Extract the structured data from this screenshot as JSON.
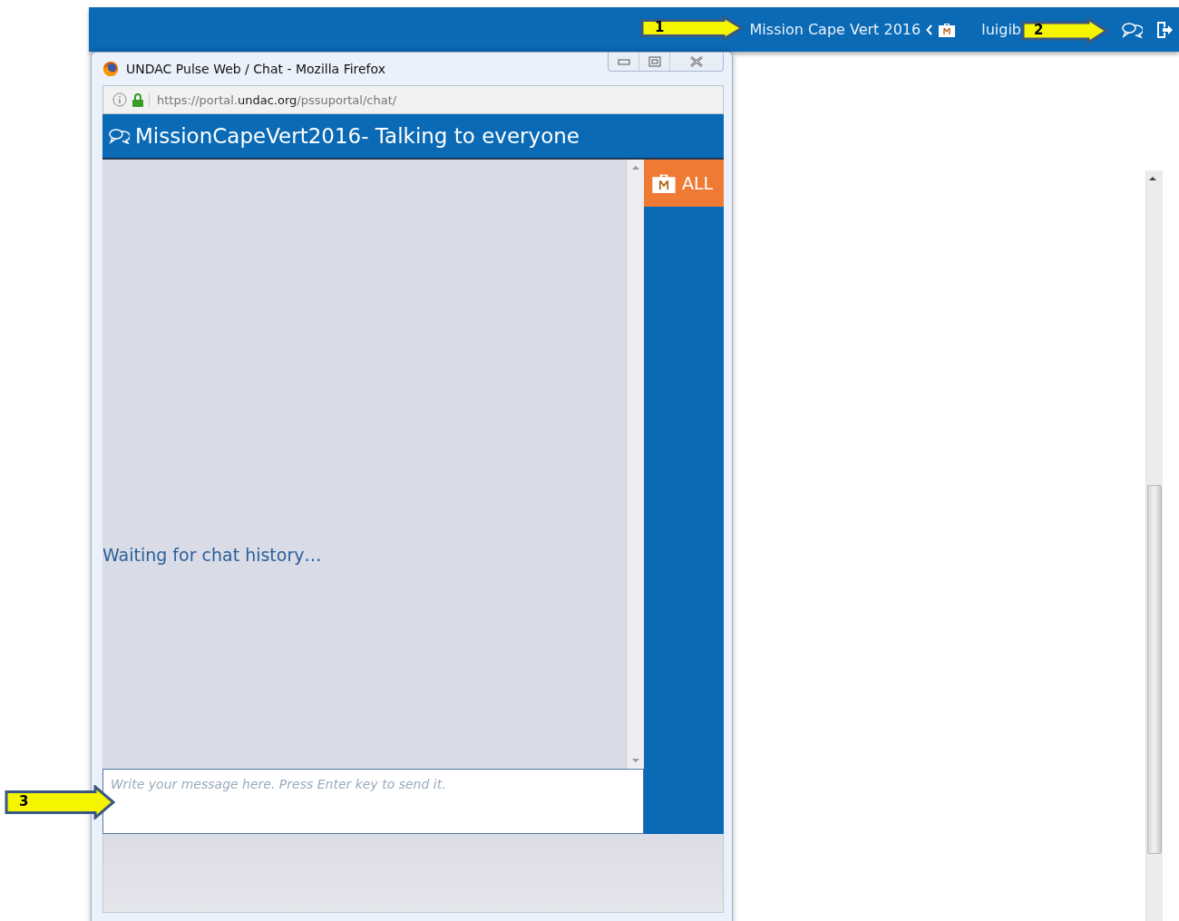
{
  "header": {
    "mission": "Mission Cape Vert 2016",
    "user": "luigib"
  },
  "popup": {
    "window_title": "UNDAC Pulse Web / Chat - Mozilla Firefox",
    "url": {
      "prefix": "https://portal.",
      "domain": "undac.org",
      "path": "/pssuportal/chat/"
    },
    "chat_title": "MissionCapeVert2016- Talking to everyone",
    "status": "Waiting for chat history…",
    "channels": [
      {
        "label": "ALL",
        "selected": true
      }
    ],
    "message": {
      "placeholder": "Write your message here. Press Enter key to send it."
    }
  },
  "callouts": [
    {
      "number": "1"
    },
    {
      "number": "2"
    },
    {
      "number": "3"
    }
  ]
}
